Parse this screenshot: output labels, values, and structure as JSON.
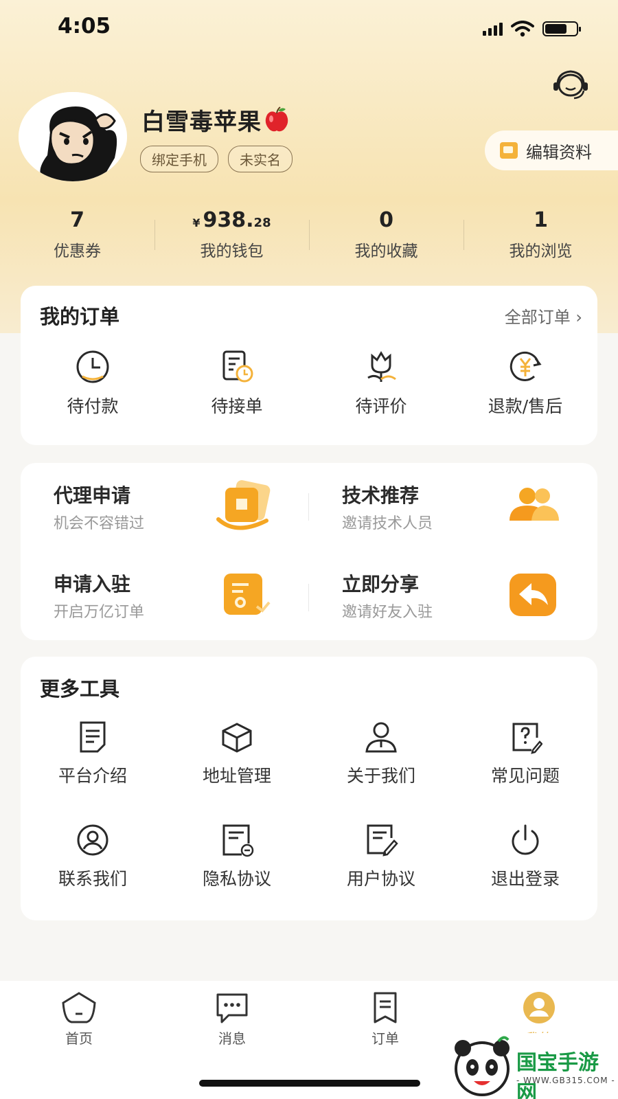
{
  "status_bar": {
    "time": "4:05"
  },
  "profile": {
    "username": "白雪毒苹果",
    "tags": [
      "绑定手机",
      "未实名"
    ],
    "edit_label": "编辑资料"
  },
  "stats": [
    {
      "value": "7",
      "label": "优惠券"
    },
    {
      "currency": "¥",
      "value_int": "938.",
      "value_dec": "28",
      "label": "我的钱包"
    },
    {
      "value": "0",
      "label": "我的收藏"
    },
    {
      "value": "1",
      "label": "我的浏览"
    }
  ],
  "orders": {
    "title": "我的订单",
    "all_label": "全部订单 ›",
    "items": [
      {
        "label": "待付款",
        "icon": "clock-icon"
      },
      {
        "label": "待接单",
        "icon": "document-clock-icon"
      },
      {
        "label": "待评价",
        "icon": "flower-icon"
      },
      {
        "label": "退款/售后",
        "icon": "refund-icon"
      }
    ]
  },
  "promos": [
    {
      "title": "代理申请",
      "subtitle": "机会不容错过"
    },
    {
      "title": "技术推荐",
      "subtitle": "邀请技术人员"
    },
    {
      "title": "申请入驻",
      "subtitle": "开启万亿订单"
    },
    {
      "title": "立即分享",
      "subtitle": "邀请好友入驻"
    }
  ],
  "tools": {
    "title": "更多工具",
    "items": [
      {
        "label": "平台介绍",
        "icon": "note-icon"
      },
      {
        "label": "地址管理",
        "icon": "box-icon"
      },
      {
        "label": "关于我们",
        "icon": "person-icon"
      },
      {
        "label": "常见问题",
        "icon": "question-doc-icon"
      },
      {
        "label": "联系我们",
        "icon": "contact-icon"
      },
      {
        "label": "隐私协议",
        "icon": "privacy-doc-icon"
      },
      {
        "label": "用户协议",
        "icon": "edit-doc-icon"
      },
      {
        "label": "退出登录",
        "icon": "power-icon"
      }
    ]
  },
  "tabbar": [
    {
      "label": "首页",
      "icon": "home-icon"
    },
    {
      "label": "消息",
      "icon": "message-icon"
    },
    {
      "label": "订单",
      "icon": "order-icon"
    },
    {
      "label": "我的",
      "icon": "profile-icon"
    }
  ],
  "watermark": {
    "text": "国宝手游网",
    "sub": "- WWW.GB315.COM -"
  },
  "colors": {
    "accent": "#f4b23a",
    "header_bg": "#f7e3b2",
    "text_dark": "#222222"
  }
}
